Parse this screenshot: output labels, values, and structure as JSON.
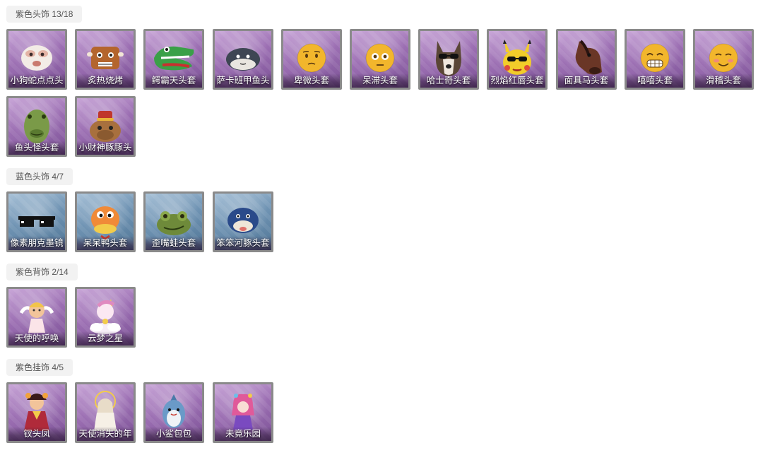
{
  "sections": [
    {
      "title": "紫色头饰 13/18",
      "rarity": "purple",
      "items": [
        {
          "name": "小狗蛇点点头",
          "icon": "white-puppy-face-icon"
        },
        {
          "name": "炙热烧烤",
          "icon": "grilled-meat-mask-icon"
        },
        {
          "name": "鳄霸天头套",
          "icon": "crocodile-head-icon"
        },
        {
          "name": "萨卡班甲鱼头",
          "icon": "sacabambaspis-fish-head-icon"
        },
        {
          "name": "卑微头套",
          "icon": "timid-emoji-head-icon"
        },
        {
          "name": "呆滞头套",
          "icon": "dazed-emoji-head-icon"
        },
        {
          "name": "哈士奇头套",
          "icon": "husky-head-sunglasses-icon"
        },
        {
          "name": "烈焰红唇头套",
          "icon": "yellow-mouse-sunglasses-icon"
        },
        {
          "name": "面具马头套",
          "icon": "horse-head-mask-icon"
        },
        {
          "name": "嘻嘻头套",
          "icon": "grinning-emoji-head-icon"
        },
        {
          "name": "滑稽头套",
          "icon": "funny-emoji-head-icon"
        },
        {
          "name": "鱼头怪头套",
          "icon": "green-fish-head-icon"
        },
        {
          "name": "小财神豚豚头",
          "icon": "fortune-capybara-head-icon"
        }
      ]
    },
    {
      "title": "蓝色头饰 4/7",
      "rarity": "blue",
      "items": [
        {
          "name": "像素朋克墨镜",
          "icon": "pixel-sunglasses-icon"
        },
        {
          "name": "呆呆鸭头套",
          "icon": "silly-duck-head-icon"
        },
        {
          "name": "歪嘴蛙头套",
          "icon": "crooked-frog-head-icon"
        },
        {
          "name": "笨笨河豚头套",
          "icon": "pufferfish-head-icon"
        }
      ]
    },
    {
      "title": "紫色背饰 2/14",
      "rarity": "purple",
      "items": [
        {
          "name": "天使的呼唤",
          "icon": "angel-doll-icon"
        },
        {
          "name": "云梦之星",
          "icon": "cloud-unicorn-doll-icon"
        }
      ]
    },
    {
      "title": "紫色挂饰 4/5",
      "rarity": "purple",
      "items": [
        {
          "name": "钗头凤",
          "icon": "phoenix-hairpin-girl-icon"
        },
        {
          "name": "天使消失的年",
          "icon": "fading-angel-girl-icon"
        },
        {
          "name": "小鲨包包",
          "icon": "little-shark-bag-icon"
        },
        {
          "name": "未竟乐园",
          "icon": "unfinished-paradise-girl-icon"
        }
      ]
    }
  ]
}
